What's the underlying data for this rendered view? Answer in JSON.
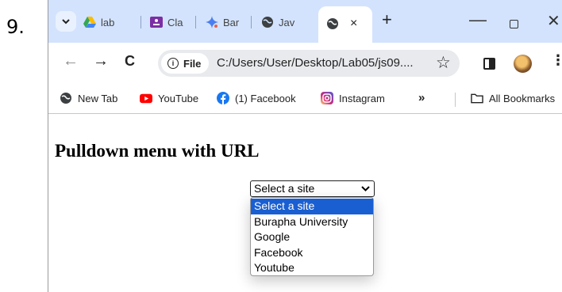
{
  "item_number": "9.",
  "colors": {
    "tabstrip_bg": "#d3e3fd",
    "selected_option_bg": "#1a5fd1",
    "omnibox_bg": "#e8eaed"
  },
  "tabs": [
    {
      "label": "lab",
      "icon": "google-drive-icon"
    },
    {
      "label": "Cla",
      "icon": "google-classroom-icon"
    },
    {
      "label": "Bar",
      "icon": "gemini-icon"
    },
    {
      "label": "Jav",
      "icon": "globe-icon"
    }
  ],
  "active_tab": {
    "icon": "globe-icon",
    "close_label": "×"
  },
  "new_tab_label": "+",
  "window_controls": {
    "minimize": "—",
    "close": "✕"
  },
  "toolbar": {
    "back": "←",
    "forward": "→",
    "reload": "C",
    "site_chip_label": "File",
    "url": "C:/Users/User/Desktop/Lab05/js09....",
    "star": "☆"
  },
  "bookmarks": [
    {
      "label": "New Tab",
      "icon": "globe-icon"
    },
    {
      "label": "YouTube",
      "icon": "youtube-icon"
    },
    {
      "label": "(1) Facebook",
      "icon": "facebook-icon"
    },
    {
      "label": "Instagram",
      "icon": "instagram-icon"
    }
  ],
  "bookmarks_more": "»",
  "all_bookmarks_label": "All Bookmarks",
  "page": {
    "heading": "Pulldown menu with URL",
    "select_value": "Select a site",
    "options": [
      "Select a site",
      "Burapha University",
      "Google",
      "Facebook",
      "Youtube"
    ],
    "selected_index": 0
  }
}
